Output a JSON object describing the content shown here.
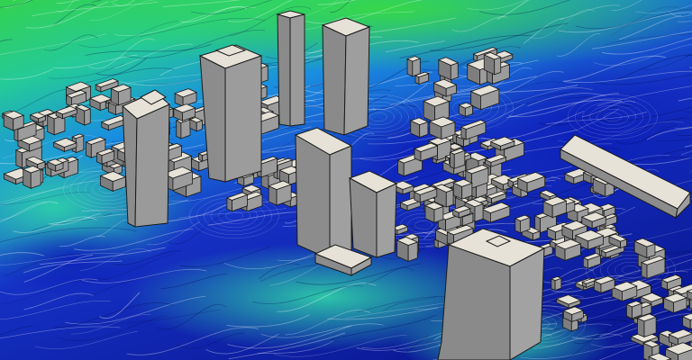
{
  "scene": {
    "subject": "aerial-cfd-wind-flow-over-city",
    "colors": {
      "flow_green": "#2fd84a",
      "flow_cyan": "#1fc6c8",
      "flow_blue": "#1426c8",
      "flow_deep": "#0a1a8a",
      "building_light": "#e6e2d8",
      "building_shade": "#8c8c8c",
      "building_dark": "#6e6e6e",
      "edge": "#1a1a1a"
    }
  }
}
